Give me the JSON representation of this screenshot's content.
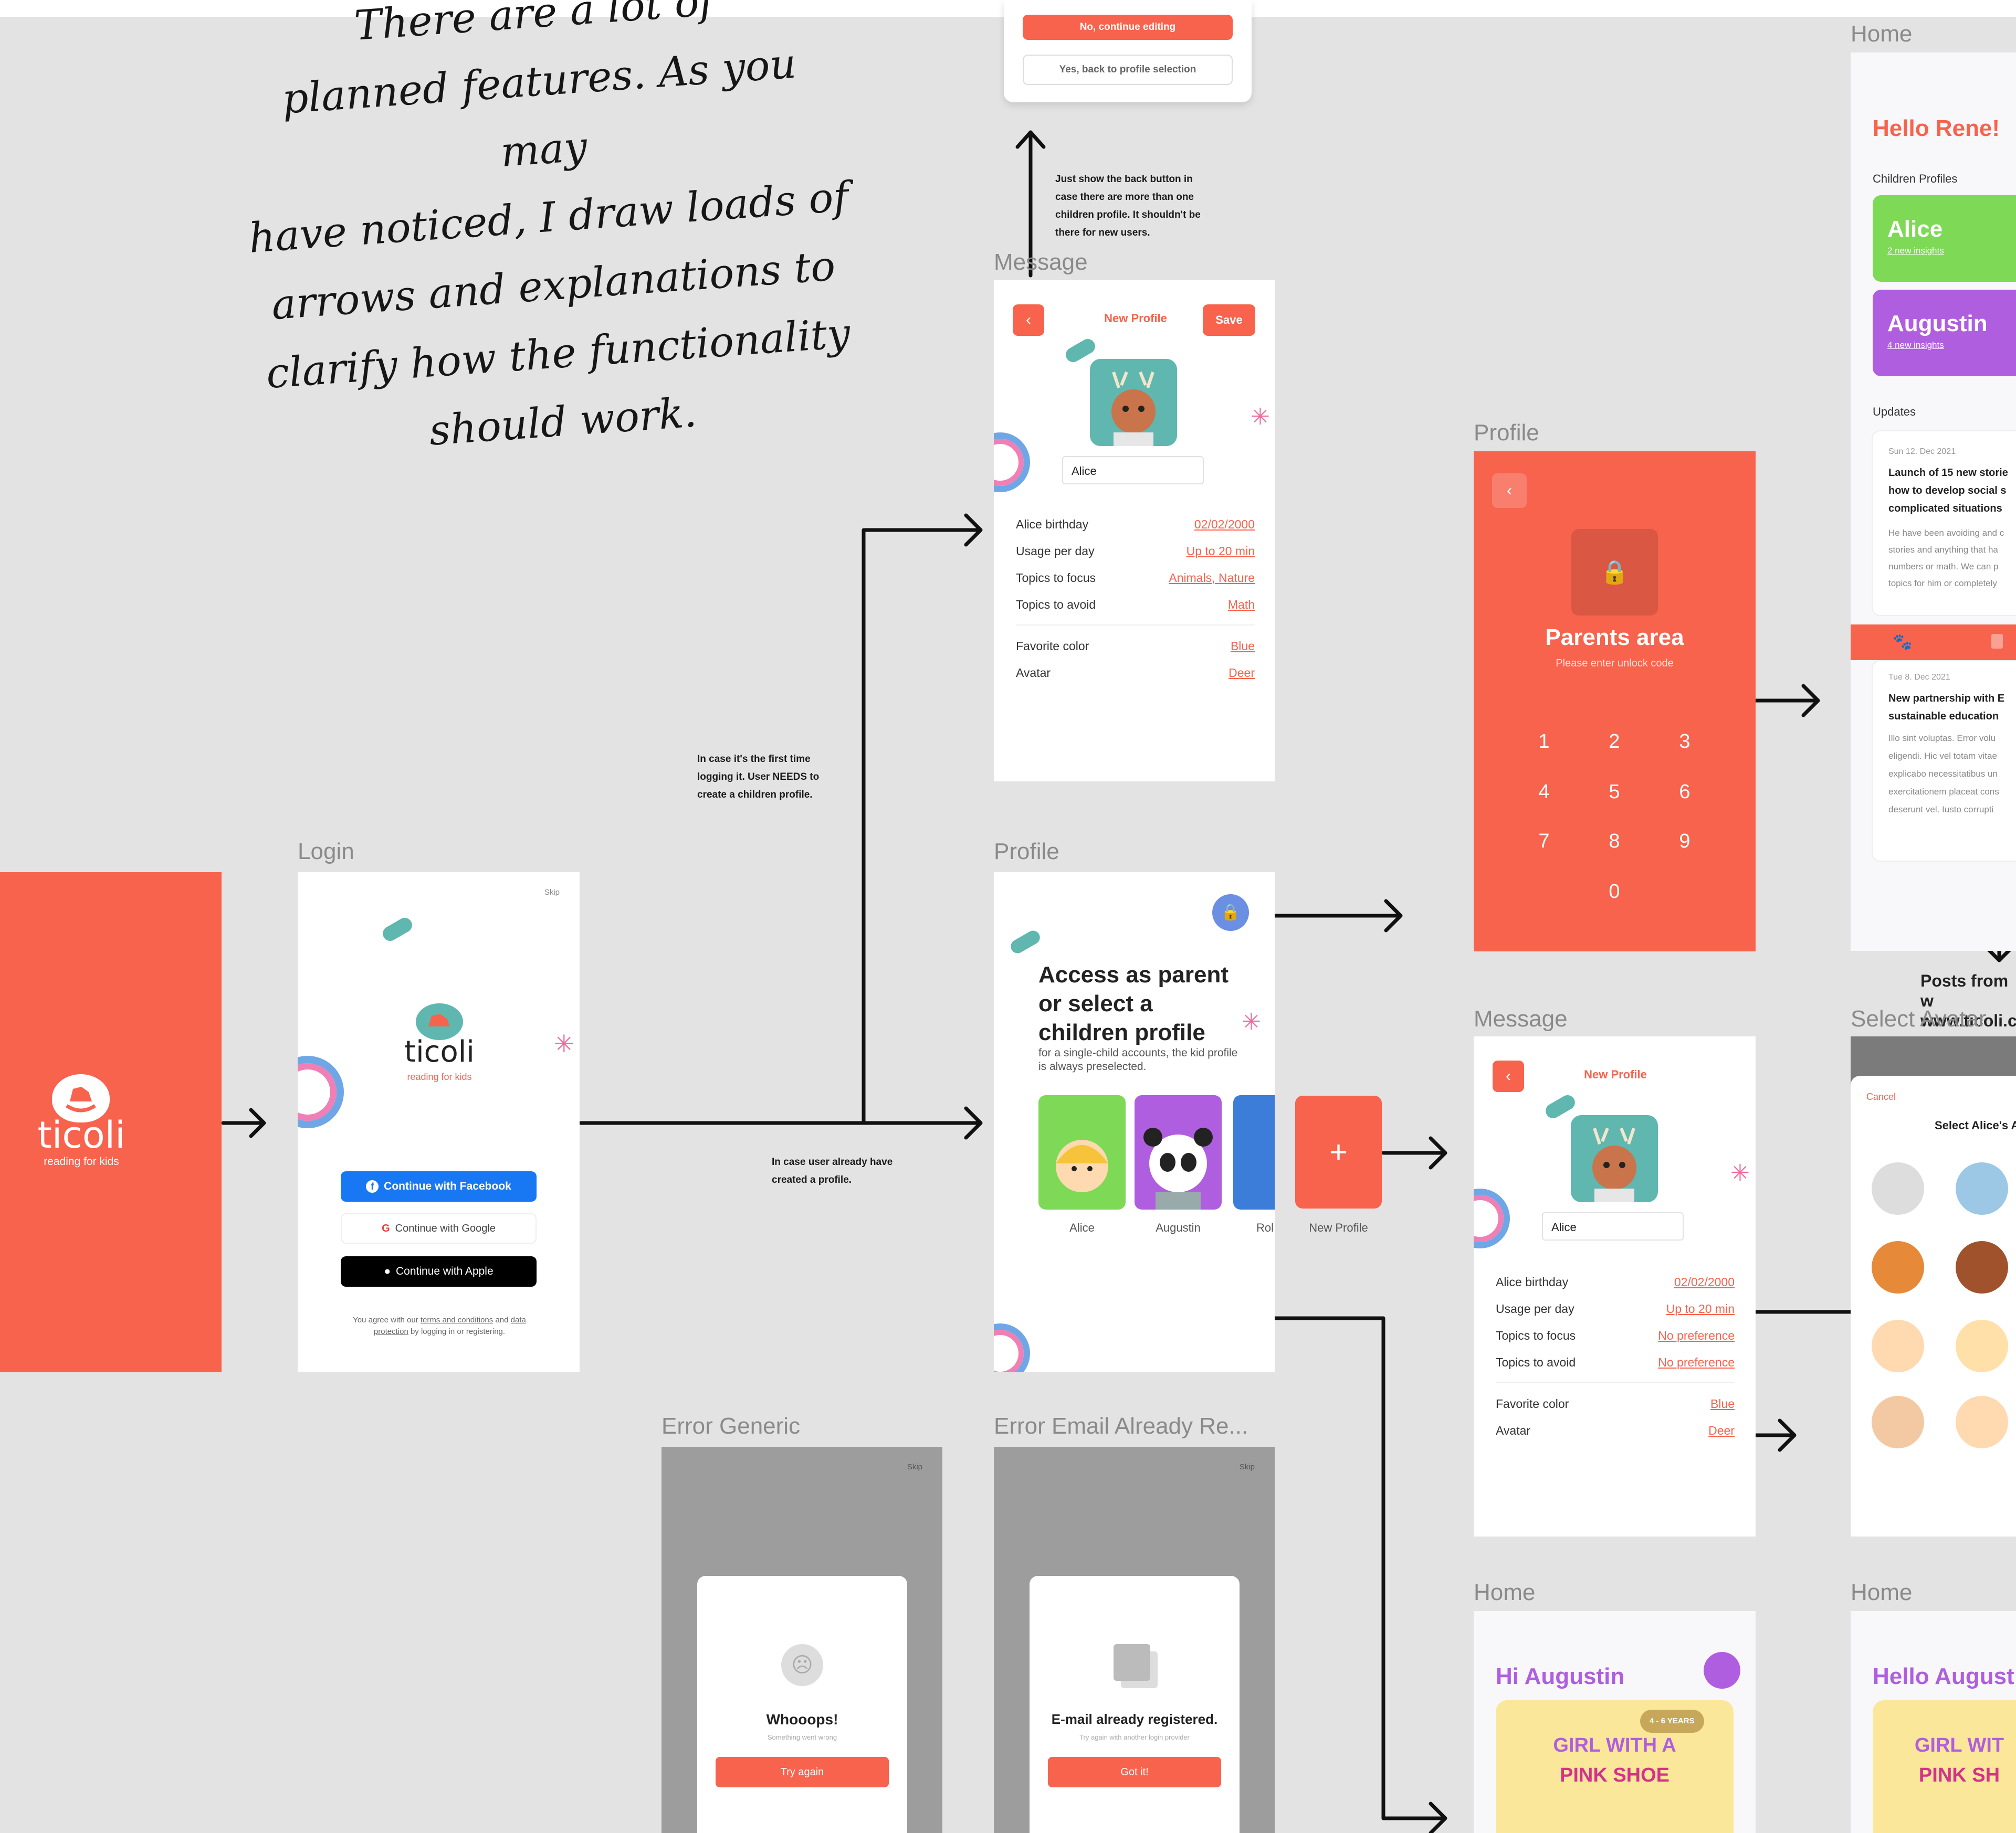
{
  "handwritten_note": {
    "lines": [
      "There are a lot of",
      "planned features. As you may",
      "have noticed, I draw loads of",
      "arrows and explanations to",
      "clarify how the functionality",
      "should work."
    ]
  },
  "frames": {
    "login": "Login",
    "message_top": "Message",
    "profile_center": "Profile",
    "profile_right": "Profile",
    "message_right": "Message",
    "home_top": "Home",
    "select_avatar": "Select Avatar",
    "error_generic": "Error Generic",
    "error_email": "Error Email Already Re...",
    "home_bottom_1": "Home",
    "home_bottom_2": "Home"
  },
  "annotations": {
    "first_time": [
      "In case it's the first time",
      "logging it. User NEEDS to",
      "create a children profile."
    ],
    "already_profile": [
      "In case user already have",
      "created a profile."
    ],
    "back_button": [
      "Just show the back button in",
      "case there are more than one",
      "children profile. It shouldn't be",
      "there for new users."
    ],
    "posts_from": [
      "Posts from w",
      "www.ticoli.c"
    ]
  },
  "modal_top": {
    "continue_editing": "No, continue editing",
    "back_to_selection": "Yes, back to profile selection"
  },
  "splash": {
    "brand": "ticoli",
    "tagline": "reading for kids"
  },
  "login": {
    "skip": "Skip",
    "brand": "ticoli",
    "tagline": "reading for kids",
    "facebook": "Continue with Facebook",
    "google": "Continue with Google",
    "apple": "Continue with Apple",
    "legal_1": "You agree with our",
    "terms": "terms and conditions",
    "and": "and",
    "data": "data",
    "protection": "protection",
    "legal_2": "by logging in or registering."
  },
  "new_profile": {
    "title": "New Profile",
    "save": "Save",
    "name": "Alice",
    "fields": [
      {
        "label": "Alice birthday",
        "value": "02/02/2000"
      },
      {
        "label": "Usage per day",
        "value": "Up to 20 min"
      },
      {
        "label": "Topics to focus",
        "value": "Animals, Nature"
      },
      {
        "label": "Topics to avoid",
        "value": "Math"
      }
    ],
    "fields2": [
      {
        "label": "Favorite color",
        "value": "Blue"
      },
      {
        "label": "Avatar",
        "value": "Deer"
      }
    ]
  },
  "profile_select": {
    "heading_1": "Access as parent",
    "heading_2": "or select a",
    "heading_3": "children profile",
    "sub": "for a single-child accounts, the kid profile is always preselected.",
    "kids": [
      "Alice",
      "Augustin",
      "Rol"
    ],
    "new_profile": "New Profile",
    "plus": "+"
  },
  "parents": {
    "title": "Parents area",
    "sub": "Please enter unlock code",
    "keys": [
      "1",
      "2",
      "3",
      "4",
      "5",
      "6",
      "7",
      "8",
      "9",
      "0"
    ]
  },
  "message_right": {
    "title": "New Profile",
    "name": "Alice",
    "fields": [
      {
        "label": "Alice birthday",
        "value": "02/02/2000"
      },
      {
        "label": "Usage per day",
        "value": "Up to 20 min"
      },
      {
        "label": "Topics to focus",
        "value": "No preference"
      },
      {
        "label": "Topics to avoid",
        "value": "No preference"
      }
    ],
    "fields2": [
      {
        "label": "Favorite color",
        "value": "Blue"
      },
      {
        "label": "Avatar",
        "value": "Deer"
      }
    ]
  },
  "home": {
    "greeting": "Hello Rene!",
    "children_profiles": "Children Profiles",
    "alice": "Alice",
    "alice_insights": "2 new insights",
    "augustin": "Augustin",
    "augustin_insights": "4 new insights",
    "updates": "Updates",
    "post1_date": "Sun 12. Dec 2021",
    "post1_title": "Launch of 15 new storie how to develop social s complicated situations",
    "post1_body": "He have been avoiding and c stories and anything that ha numbers or math. We can p topics for him or completely",
    "post2_date": "Tue 8. Dec 2021",
    "post2_title": "New partnership with E sustainable education",
    "post2_body": "Illo sint voluptas. Error volu eligendi. Hic vel totam vitae explicabo necessitatibus un exercitationem placeat cons deserunt vel. Iusto corrupti"
  },
  "select_avatar": {
    "cancel": "Cancel",
    "title": "Select Alice's A"
  },
  "error_generic": {
    "skip": "Skip",
    "title": "Whooops!",
    "sub": "Something went wrong",
    "button": "Try again"
  },
  "error_email": {
    "skip": "Skip",
    "title": "E-mail already registered.",
    "sub": "Try again with another login provider",
    "button": "Got it!"
  },
  "home_bottom_1": {
    "greeting": "Hi Augustin",
    "age": "4 - 6 YEARS",
    "book_1": "GIRL WITH A",
    "book_2": "PINK SHOE"
  },
  "home_bottom_2": {
    "greeting": "Hello August",
    "book_1": "GIRL WIT",
    "book_2": "PINK SH"
  },
  "colors": {
    "coral": "#f7634d",
    "green": "#7ed957",
    "purple": "#b05ee0",
    "facebook": "#1877f2",
    "teal": "#5fb7b0"
  }
}
